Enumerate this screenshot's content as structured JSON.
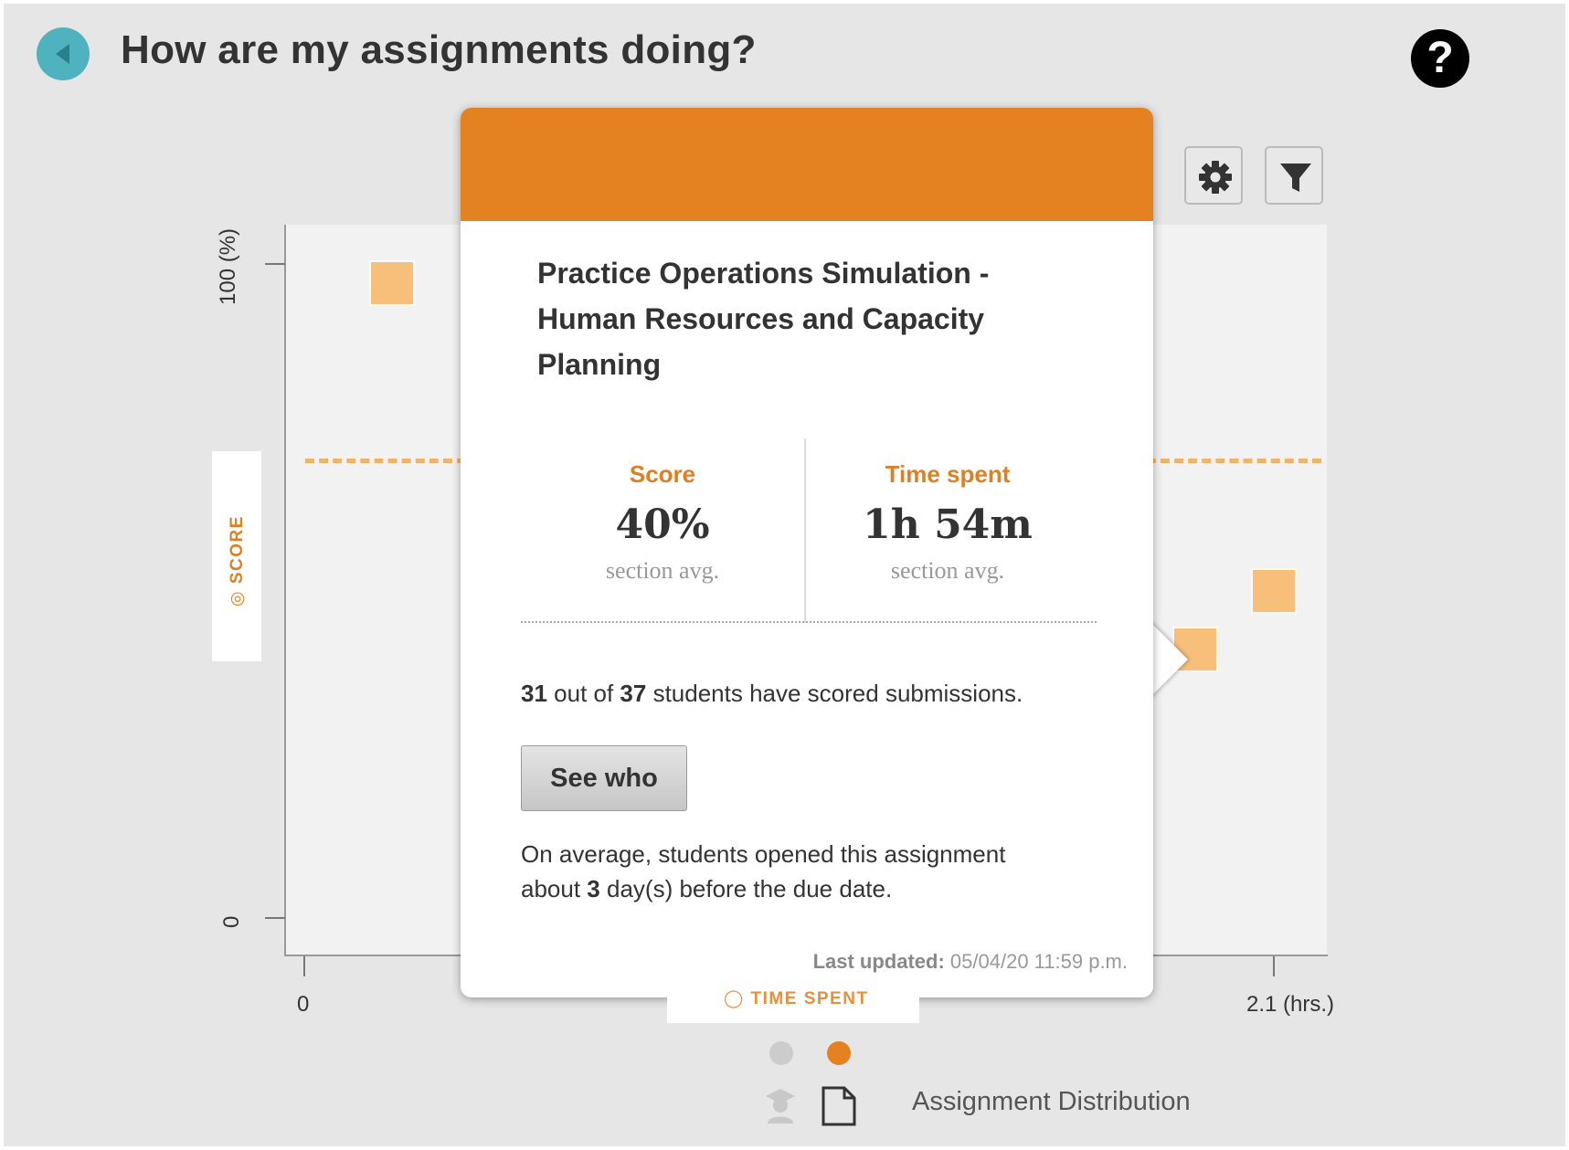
{
  "header": {
    "title": "How are my assignments doing?",
    "back_icon": "back-arrow-icon",
    "help_icon": "help-question-icon",
    "help_glyph": "?"
  },
  "toolbar": {
    "settings_icon": "gear-icon",
    "filter_icon": "filter-icon"
  },
  "chart": {
    "y_top_label": "100 (%)",
    "y_bottom_label": "0",
    "x_left_label": "0",
    "x_right_label": "2.1 (hrs.)",
    "y_axis_tab": "SCORE",
    "x_axis_tab": "TIME SPENT",
    "score_icon": "target-icon",
    "time_icon": "clock-icon"
  },
  "chart_data": {
    "type": "scatter",
    "xlabel": "TIME SPENT",
    "ylabel": "SCORE",
    "xlim": [
      0,
      2.1
    ],
    "ylim": [
      0,
      100
    ],
    "average_line_y": 70,
    "points": [
      {
        "x": 0.19,
        "y": 97
      },
      {
        "x": 1.93,
        "y": 41
      },
      {
        "x": 2.1,
        "y": 50
      }
    ],
    "colors": {
      "points": "#f8bf7a",
      "average_line": "#f0b468"
    }
  },
  "popover": {
    "assignment_title": "Practice Operations Simulation - Human Resources and Capacity Planning",
    "score_label": "Score",
    "score_value": "40%",
    "score_sub": "section avg.",
    "time_label": "Time spent",
    "time_value": "1h 54m",
    "time_sub": "section avg.",
    "scored_count": "31",
    "scored_mid": " out of ",
    "total_students": "37",
    "scored_suffix": " students have scored submissions.",
    "see_who_label": "See who",
    "opened_prefix": "On average, students opened this assignment about ",
    "opened_days": "3",
    "opened_suffix": " day(s) before the due date.",
    "last_updated_label": "Last updated:",
    "last_updated_value": " 05/04/20 11:59 p.m.",
    "header_color": "#e48121"
  },
  "pager": {
    "dots": [
      {
        "name": "page-dot-1",
        "active": false
      },
      {
        "name": "page-dot-2",
        "active": true
      }
    ]
  },
  "footer": {
    "student_icon": "student-icon",
    "document_icon": "document-icon",
    "label": "Assignment Distribution"
  },
  "colors": {
    "accent": "#e48121",
    "back_button": "#4fb3bf",
    "background": "#e6e6e6"
  }
}
